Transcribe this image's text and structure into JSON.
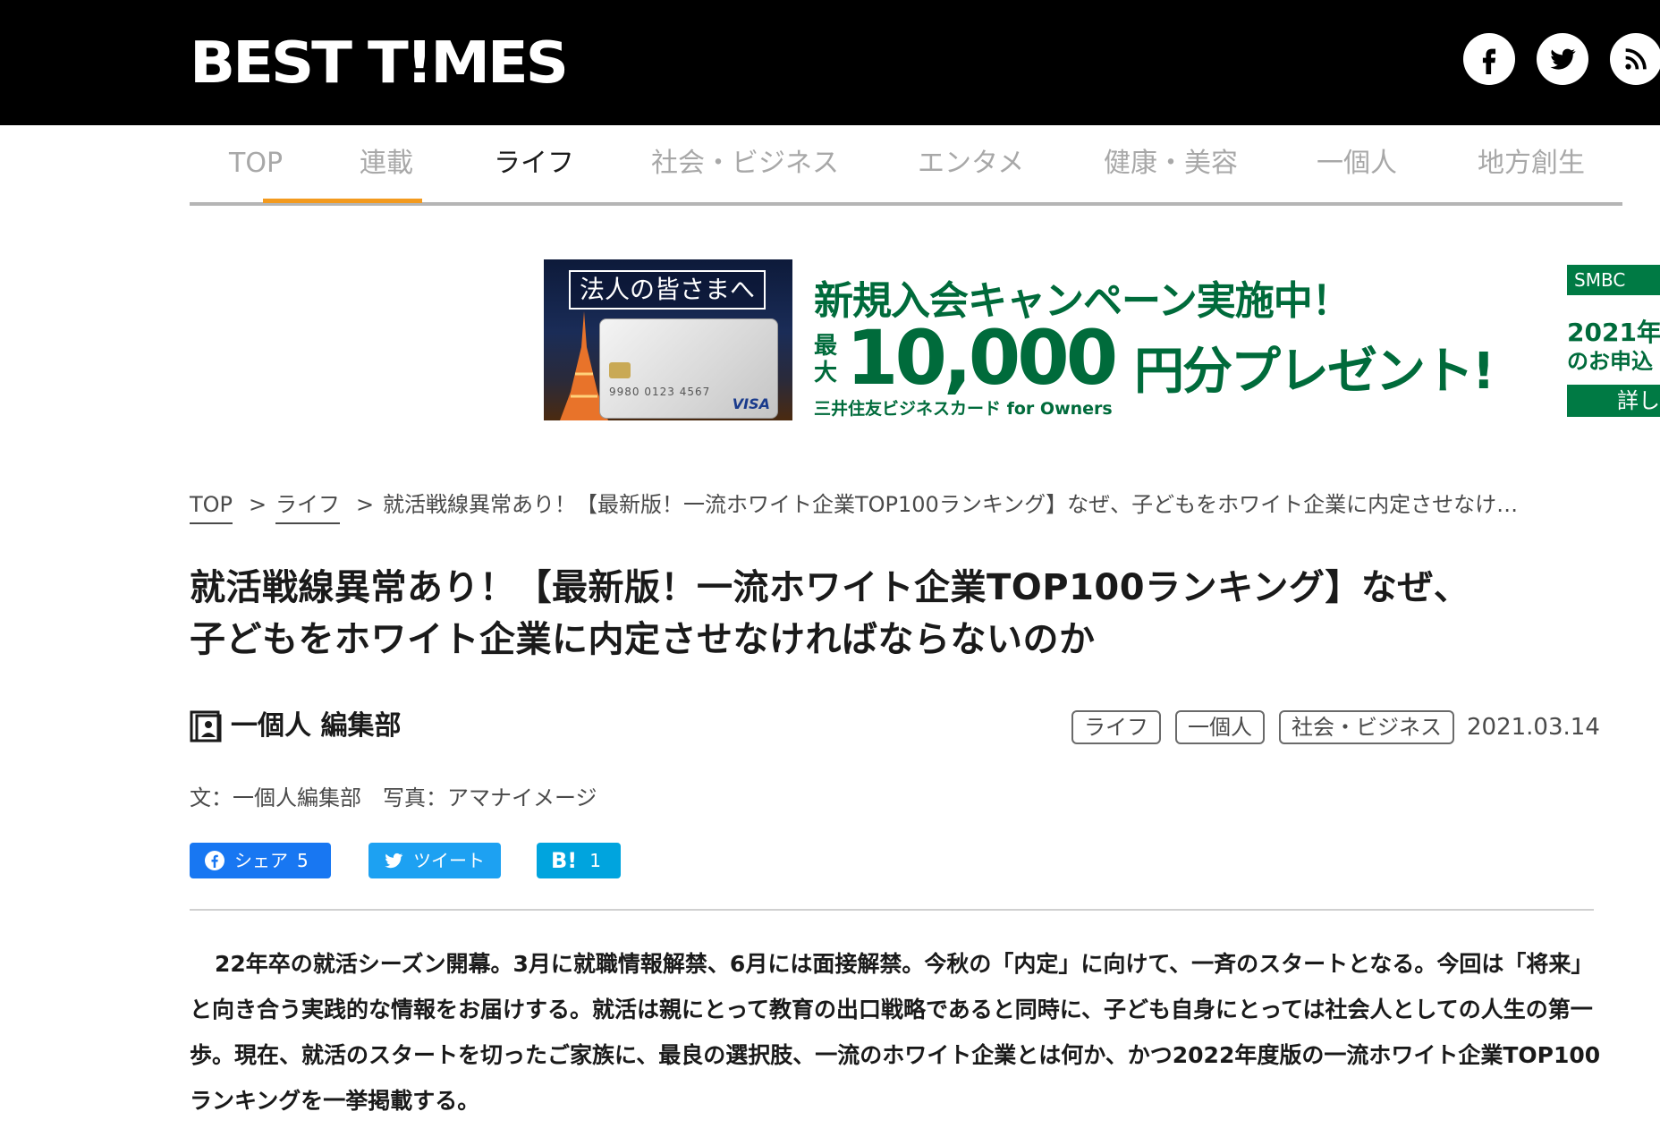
{
  "header": {
    "logo": "BEST T!MES",
    "social": [
      "facebook-icon",
      "twitter-icon",
      "rss-icon"
    ]
  },
  "nav": {
    "items": [
      {
        "label": "TOP"
      },
      {
        "label": "連載"
      },
      {
        "label": "ライフ"
      },
      {
        "label": "社会・ビジネス"
      },
      {
        "label": "エンタメ"
      },
      {
        "label": "健康・美容"
      },
      {
        "label": "一個人"
      },
      {
        "label": "地方創生"
      }
    ],
    "active_index": 2,
    "accent_color": "#f39a1e"
  },
  "ad": {
    "photo_title": "法人の皆さまへ",
    "headline": "新規入会キャンペーン実施中！",
    "prefix": "最大",
    "amount": "10,000",
    "suffix": "円分プレゼント!",
    "subline": "三井住友ビジネスカード for Owners",
    "card_visa": "VISA",
    "card_number": "9980 0123 4567",
    "right_brand": "SMBC",
    "right_year": "2021年",
    "right_apply": "のお申込",
    "right_detail": "詳し",
    "brand_color": "#006b3b"
  },
  "breadcrumb": {
    "items": [
      "TOP",
      "ライフ"
    ],
    "current": "就活戦線異常あり！【最新版！一流ホワイト企業TOP100ランキング】なぜ、子どもをホワイト企業に内定させなけ…",
    "separator": ">"
  },
  "article": {
    "title_line1": "就活戦線異常あり！【最新版！一流ホワイト企業TOP100ランキング】なぜ、",
    "title_line2": "子どもをホワイト企業に内定させなければならないのか",
    "author": "一個人 編集部",
    "tags": [
      "ライフ",
      "一個人",
      "社会・ビジネス"
    ],
    "date": "2021.03.14",
    "credit": "文：一個人編集部　写真：アマナイメージ",
    "body": "22年卒の就活シーズン開幕。3月に就職情報解禁、6月には面接解禁。今秋の「内定」に向けて、一斉のスタートとなる。今回は「将来」と向き合う実践的な情報をお届けする。就活は親にとって教育の出口戦略であると同時に、子ども自身にとっては社会人としての人生の第一歩。現在、就活のスタートを切ったご家族に、最良の選択肢、一流のホワイト企業とは何か、かつ2022年度版の一流ホワイト企業TOP100ランキングを一挙掲載する。"
  },
  "share": {
    "facebook_label": "シェア",
    "facebook_count": "5",
    "twitter_label": "ツイート",
    "hatena_mark": "B!",
    "hatena_count": "1",
    "colors": {
      "facebook": "#1877f2",
      "twitter": "#1da1f2",
      "hatena": "#00a4de"
    }
  }
}
